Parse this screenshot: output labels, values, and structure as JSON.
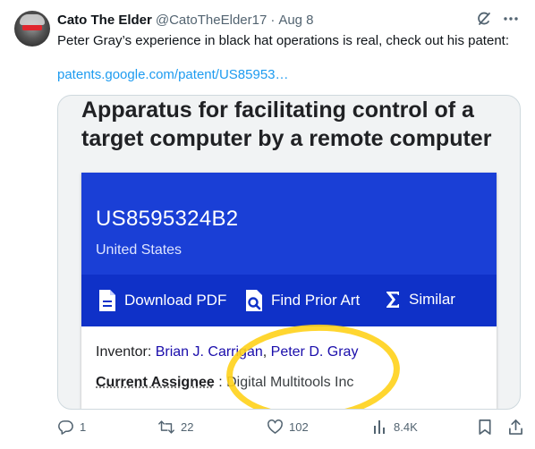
{
  "tweet": {
    "author_name": "Cato The Elder",
    "handle": "@CatoTheElder17",
    "separator": "·",
    "date": "Aug 8",
    "text": "Peter Gray’s experience in black hat operations is real, check out his patent:",
    "link": "patents.google.com/patent/US85953…"
  },
  "patent": {
    "title": "Apparatus for facilitating control of a target computer by a remote computer",
    "number": "US8595324B2",
    "country": "United States",
    "actions": {
      "download": "Download PDF",
      "prior_art": "Find Prior Art",
      "similar": "Similar"
    },
    "inventor_label": "Inventor: ",
    "inventor_1": "Brian J. Carrigan",
    "inventor_sep": ", ",
    "inventor_2": "Peter D. Gray",
    "assignee_label": "Current Assignee",
    "assignee_sep": " : ",
    "assignee_value": "Digital Multitools Inc"
  },
  "actions": {
    "replies": "1",
    "retweets": "22",
    "likes": "102",
    "views": "8.4K"
  },
  "colors": {
    "link": "#1d9bf0",
    "patent_blue": "#1a3fd6",
    "highlight_circle": "#ffd21a",
    "muted": "#536471"
  },
  "icons": [
    "grok-icon",
    "more-icon",
    "pdf-icon",
    "search-doc-icon",
    "sigma-icon",
    "reply-icon",
    "retweet-icon",
    "like-icon",
    "views-icon",
    "bookmark-icon",
    "share-icon"
  ]
}
